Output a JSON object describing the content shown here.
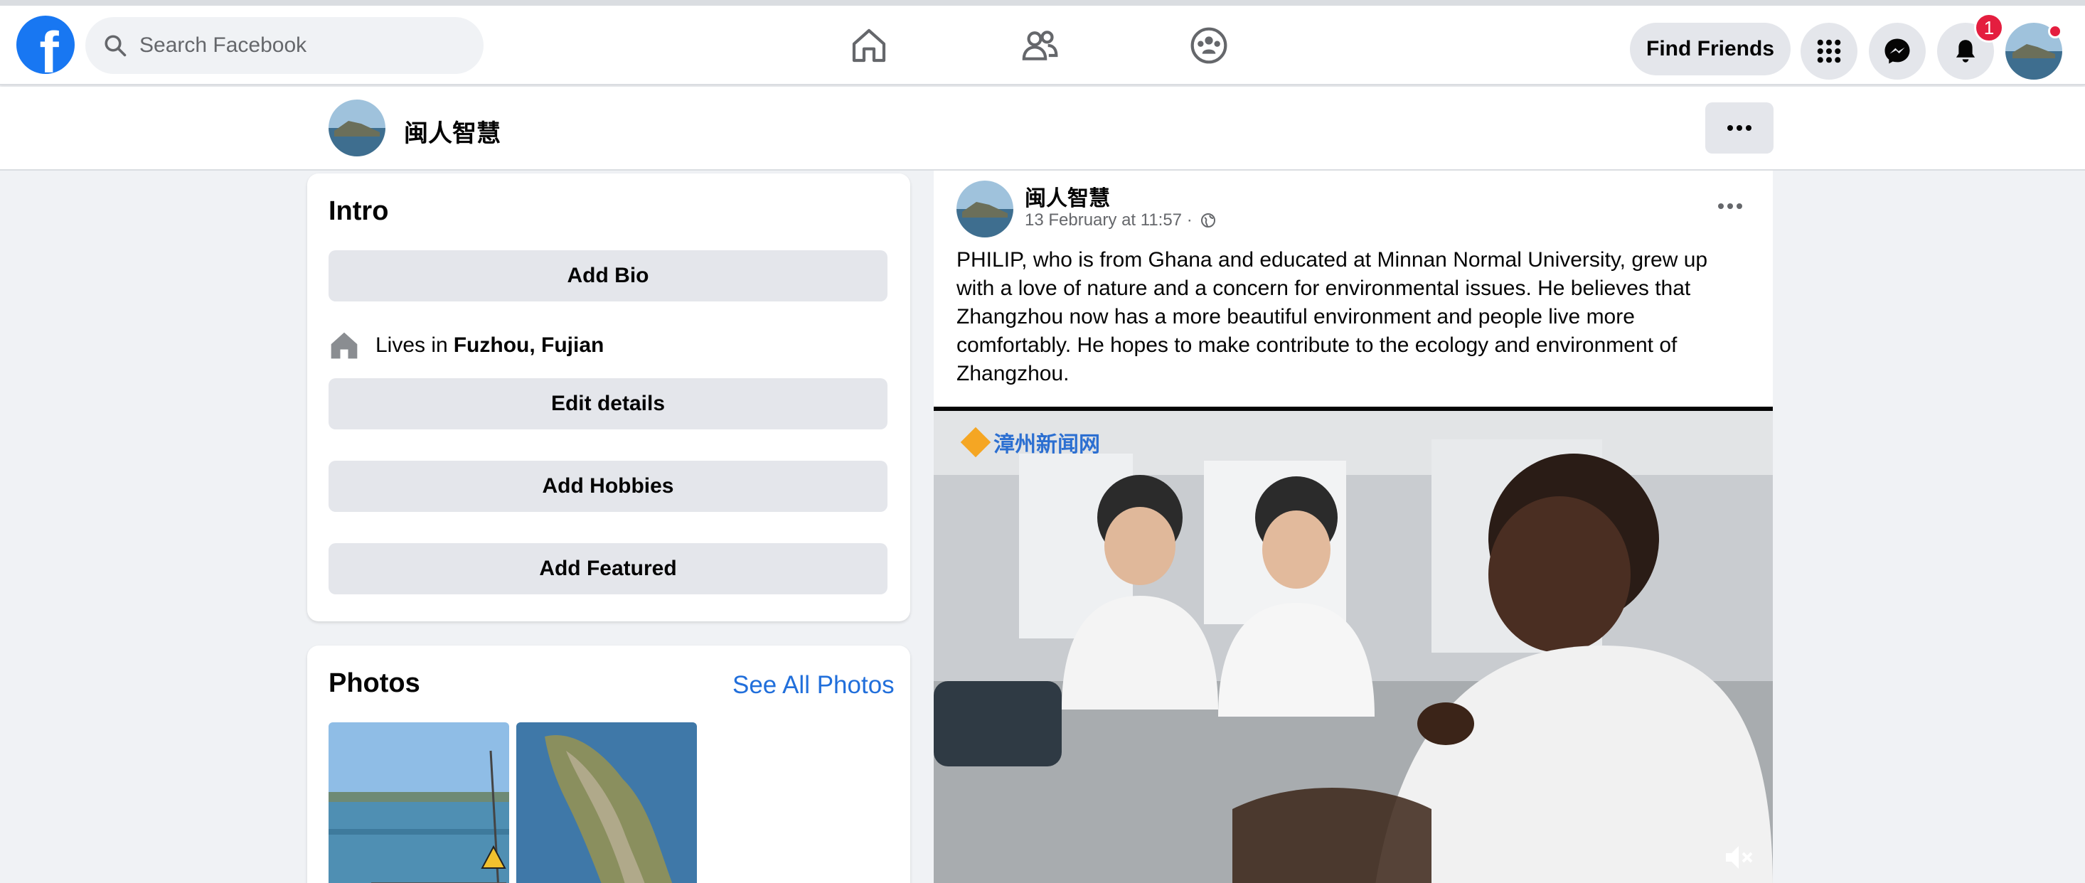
{
  "search": {
    "placeholder": "Search Facebook"
  },
  "nav": {
    "find_friends": "Find Friends",
    "notification_count": "1"
  },
  "profile": {
    "name": "闽人智慧"
  },
  "intro": {
    "title": "Intro",
    "add_bio": "Add Bio",
    "lives_prefix": "Lives in",
    "lives_place": "Fuzhou, Fujian",
    "edit_details": "Edit details",
    "add_hobbies": "Add Hobbies",
    "add_featured": "Add Featured"
  },
  "photos": {
    "title": "Photos",
    "see_all": "See All Photos"
  },
  "post": {
    "author": "闽人智慧",
    "timestamp": "13 February at 11:57 ·",
    "text": "PHILIP, who is from Ghana and educated at Minnan Normal University, grew up with a love of nature and a concern for environmental issues. He believes that Zhangzhou now has a more beautiful environment and people live more comfortably. He hopes to make contribute to the ecology and environment of Zhangzhou.",
    "video_watermark": "漳州新闻网"
  },
  "colors": {
    "brand": "#1877f2",
    "link": "#216fdb",
    "badge": "#e41e3f"
  },
  "icons": [
    "search-icon",
    "home-icon",
    "friends-icon",
    "groups-icon",
    "menu-grid-icon",
    "messenger-icon",
    "bell-icon",
    "more-icon",
    "house-icon",
    "globe-icon",
    "mute-icon"
  ]
}
